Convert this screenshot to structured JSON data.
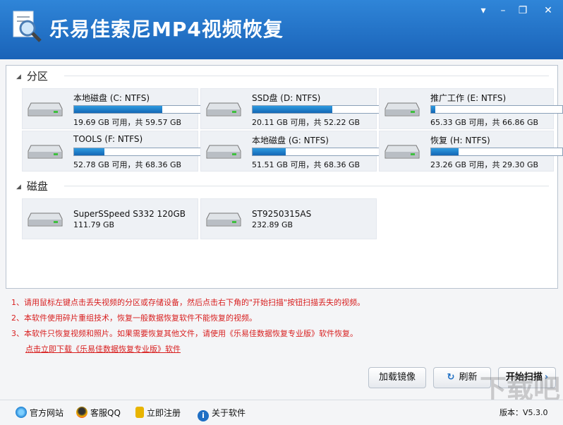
{
  "app": {
    "title": "乐易佳索尼MP4视频恢复"
  },
  "window_controls": {
    "menu": "▾",
    "minimize": "–",
    "restore": "❐",
    "close": "✕"
  },
  "partitions": {
    "header": "分区",
    "items": [
      {
        "name": "本地磁盘 (C: NTFS)",
        "size": "19.69 GB 可用，共 59.57 GB",
        "used_fraction": 0.67
      },
      {
        "name": "SSD盘 (D: NTFS)",
        "size": "20.11 GB 可用，共 52.22 GB",
        "used_fraction": 0.61
      },
      {
        "name": "推广工作 (E: NTFS)",
        "size": "65.33 GB 可用，共 66.86 GB",
        "used_fraction": 0.03
      },
      {
        "name": "TOOLS (F: NTFS)",
        "size": "52.78 GB 可用，共 68.36 GB",
        "used_fraction": 0.23
      },
      {
        "name": "本地磁盘 (G: NTFS)",
        "size": "51.51 GB 可用，共 68.36 GB",
        "used_fraction": 0.25
      },
      {
        "name": "恢复 (H: NTFS)",
        "size": "23.26 GB 可用，共 29.30 GB",
        "used_fraction": 0.21
      }
    ]
  },
  "disks": {
    "header": "磁盘",
    "items": [
      {
        "name": "SuperSSpeed S332 120GB",
        "size": "111.79 GB"
      },
      {
        "name": "ST9250315AS",
        "size": "232.89 GB"
      }
    ]
  },
  "notes": {
    "line1": "1、请用鼠标左键点击丢失视频的分区或存储设备，然后点击右下角的\"开始扫描\"按钮扫描丢失的视频。",
    "line2": "2、本软件使用碎片重组技术，恢复一般数据恢复软件不能恢复的视频。",
    "line3": "3、本软件只恢复视频和照片。如果需要恢复其他文件，请使用《乐易佳数据恢复专业版》软件恢复。",
    "link": "点击立即下载《乐易佳数据恢复专业版》软件"
  },
  "buttons": {
    "load_image": "加载镜像",
    "refresh": "刷新",
    "start_scan": "开始扫描"
  },
  "footer": {
    "website": "官方网站",
    "qq": "客服QQ",
    "register": "立即注册",
    "about": "关于软件",
    "version_label": "版本：",
    "version": "V5.3.0"
  },
  "colors": {
    "title_bar": "#1f6fc4",
    "note_red": "#d81f1f",
    "bar_fill": "#1f7fd0"
  }
}
